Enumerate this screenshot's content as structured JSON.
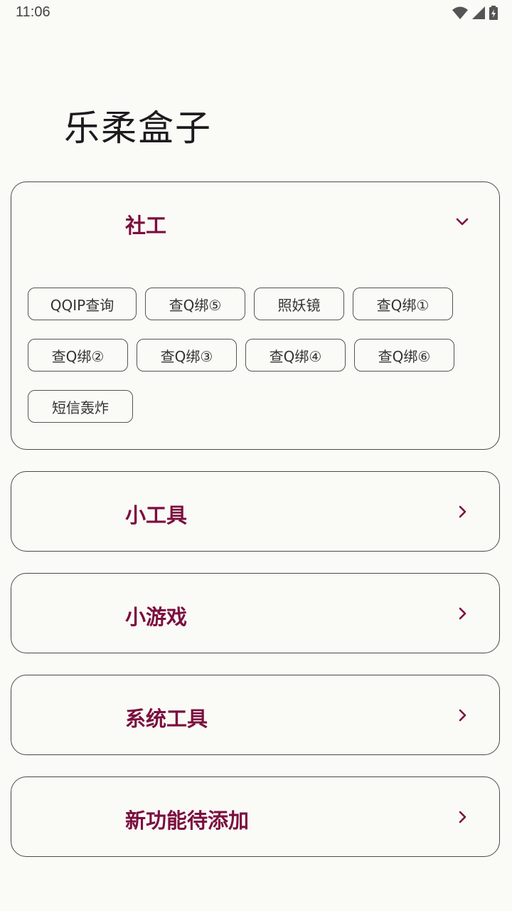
{
  "status_bar": {
    "time": "11:06"
  },
  "app": {
    "title": "乐柔盒子"
  },
  "sections": [
    {
      "title": "社工",
      "expanded": true,
      "chevron_icon": "chevron-down-icon",
      "tools": [
        "QQIP查询",
        "查Q绑⑤",
        "照妖镜",
        "查Q绑①",
        "查Q绑②",
        "查Q绑③",
        "查Q绑④",
        "查Q绑⑥",
        "短信轰炸"
      ]
    },
    {
      "title": "小工具",
      "expanded": false,
      "chevron_icon": "chevron-right-icon"
    },
    {
      "title": "小游戏",
      "expanded": false,
      "chevron_icon": "chevron-right-icon"
    },
    {
      "title": "系统工具",
      "expanded": false,
      "chevron_icon": "chevron-right-icon"
    },
    {
      "title": "新功能待添加",
      "expanded": false,
      "chevron_icon": "chevron-right-icon"
    }
  ],
  "colors": {
    "accent": "#7b0f3f",
    "background": "#fafaf6",
    "border": "#4a4a4a"
  }
}
